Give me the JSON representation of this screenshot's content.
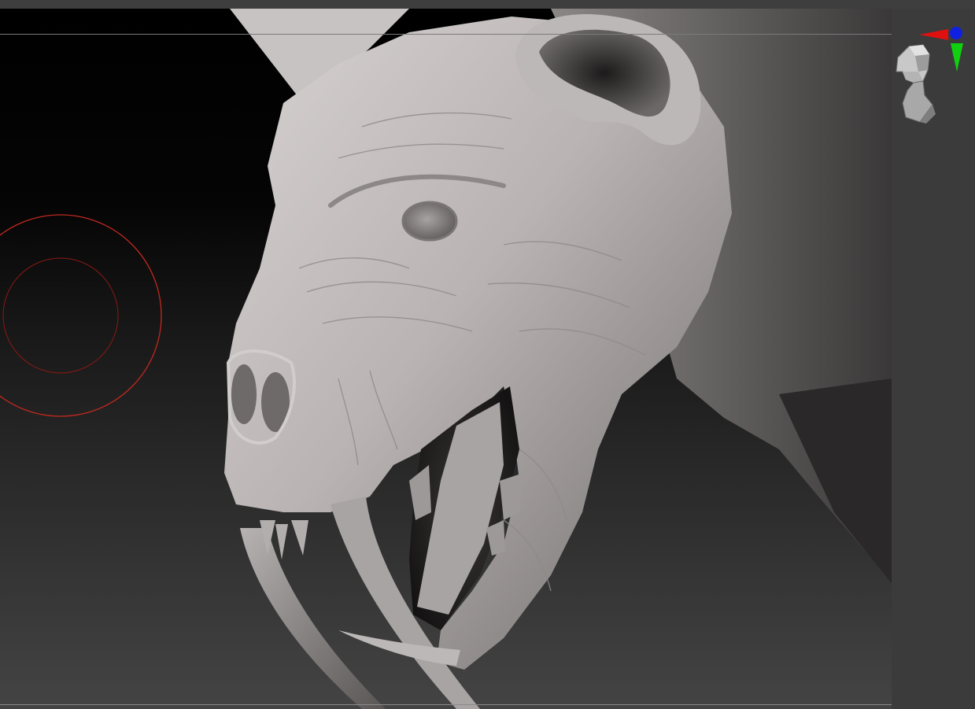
{
  "viewport": {
    "background_top": "#000000",
    "background_bottom": "#444444",
    "model_subject": "creature-head-sculpt",
    "brush_outer_color": "#c0281e",
    "brush_inner_color": "#8a1a14"
  },
  "navigation": {
    "widget_icon": "head-orientation-icon",
    "axis_x_color": "#e01010",
    "axis_y_color": "#10d010",
    "axis_z_color": "#1020e0"
  },
  "ui": {
    "panel_color": "#3b3b3b"
  }
}
